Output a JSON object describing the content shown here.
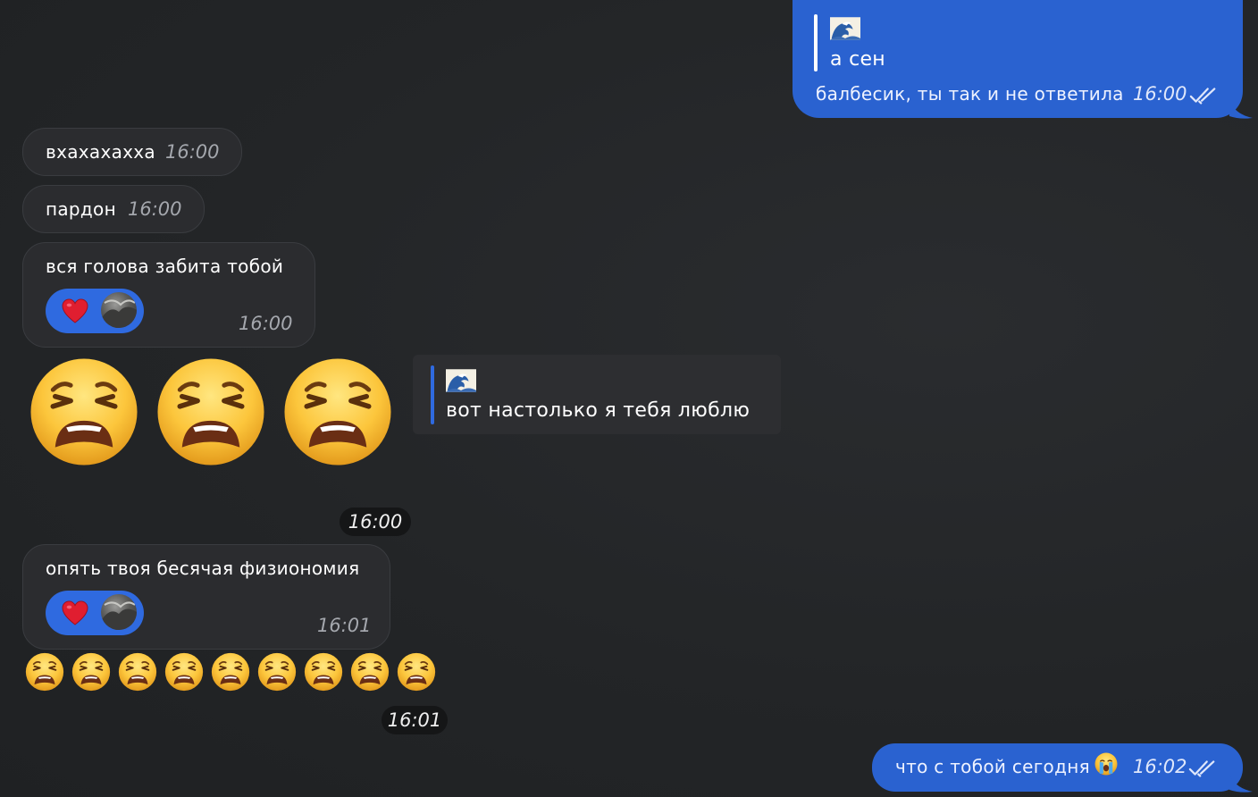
{
  "messages": {
    "out_reply": {
      "quote_text": "а сен",
      "text": "балбесик, ты так и не ответила",
      "time": "16:00"
    },
    "in1": {
      "text": "вхахахахха",
      "time": "16:00"
    },
    "in2": {
      "text": "пардон",
      "time": "16:00"
    },
    "in3": {
      "text": "вся голова забита тобой",
      "time": "16:00",
      "reaction": "heart"
    },
    "emoji_big": {
      "time": "16:00"
    },
    "in_reply": {
      "text": "вот настолько я тебя люблю"
    },
    "in4": {
      "text": "опять твоя бесячая физиономия",
      "time": "16:01",
      "reaction": "heart"
    },
    "emoji_row": {
      "time": "16:01",
      "count": 9
    },
    "out_last": {
      "text": "что с тобой сегодня",
      "time": "16:02"
    }
  },
  "colors": {
    "background": "#232527",
    "incoming_bubble": "#2b2c2f",
    "outgoing_bubble": "#2a62d0",
    "reaction_pill": "#2f6ae0"
  },
  "icons": [
    "wave-icon",
    "heart-icon",
    "weary-face-icon",
    "crying-face-icon",
    "double-check-icon",
    "avatar"
  ]
}
